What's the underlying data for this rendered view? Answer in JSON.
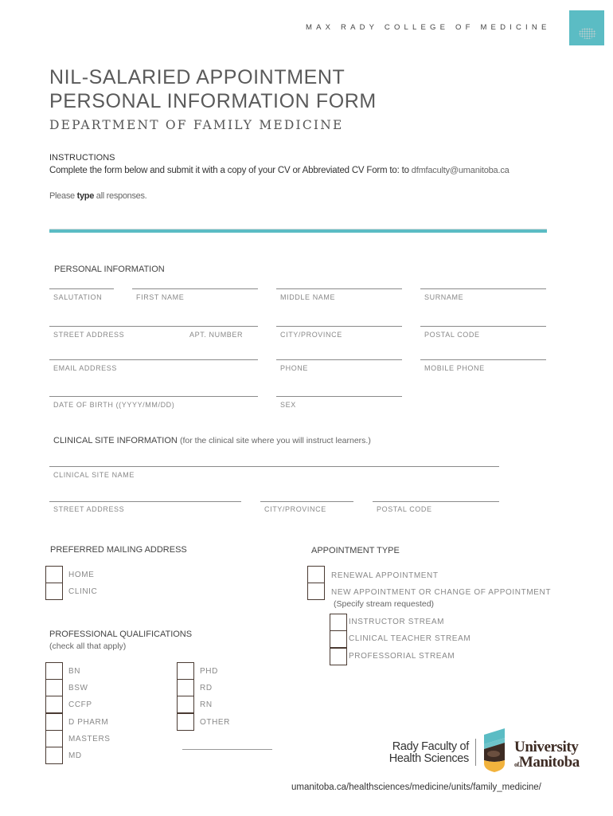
{
  "header": {
    "college": "MAX RADY COLLEGE OF MEDICINE",
    "brand_tile_icon": "medicine-brand-tile",
    "title_line1": "NIL-SALARIED APPOINTMENT",
    "title_line2": "PERSONAL INFORMATION FORM",
    "department": "DEPARTMENT OF FAMILY MEDICINE"
  },
  "instructions": {
    "heading": "INSTRUCTIONS",
    "body": "Complete the form below  and submit it with a copy of your CV or Abbreviated CV Form to: to ",
    "email": "dfmfaculty@umanitoba.ca",
    "please_prefix": "Please ",
    "please_bold": "type",
    "please_suffix": " all responses."
  },
  "colors": {
    "accent": "#5bbcc4",
    "checkbox_border": "#4a3a32",
    "um_brown": "#3d2b23",
    "um_gold": "#f2b33d"
  },
  "personal": {
    "heading": "PERSONAL INFORMATION",
    "fields": {
      "salutation": "SALUTATION",
      "first_name": "FIRST NAME",
      "middle_name": "MIDDLE NAME",
      "surname": "SURNAME",
      "street_address": "STREET ADDRESS",
      "apt_number": "APT. NUMBER",
      "city_province": "CITY/PROVINCE",
      "postal_code": "POSTAL CODE",
      "email": "EMAIL ADDRESS",
      "phone": "PHONE",
      "mobile_phone": "MOBILE PHONE",
      "dob": "DATE OF BIRTH ((YYYY/MM/DD)",
      "sex": "SEX"
    }
  },
  "clinical": {
    "heading": "CLINICAL SITE INFORMATION",
    "note": "(for the clinical site where you will instruct learners.)",
    "fields": {
      "site_name": "CLINICAL SITE NAME",
      "street_address": "STREET ADDRESS",
      "city_province": "CITY/PROVINCE",
      "postal_code": "POSTAL CODE"
    }
  },
  "mailing": {
    "heading": "PREFERRED MAILING ADDRESS",
    "options": [
      "HOME",
      "CLINIC"
    ]
  },
  "appointment": {
    "heading": "APPOINTMENT TYPE",
    "renewal": "RENEWAL APPOINTMENT",
    "new": "NEW APPOINTMENT OR CHANGE OF APPOINTMENT",
    "new_note": "(Specify stream requested)",
    "streams": [
      "INSTRUCTOR STREAM",
      "CLINICAL TEACHER STREAM",
      "PROFESSORIAL STREAM"
    ]
  },
  "qualifications": {
    "heading": "PROFESSIONAL QUALIFICATIONS",
    "note": "(check all that apply)",
    "col1": [
      "BN",
      "BSW",
      "CCFP",
      "D PHARM",
      "MASTERS",
      "MD"
    ],
    "col2": [
      "PHD",
      "RD",
      "RN",
      "OTHER"
    ]
  },
  "footer": {
    "rady_line1": "Rady Faculty of",
    "rady_line2": "Health Sciences",
    "um_line1": "University",
    "um_of": "of",
    "um_line2": "Manitoba",
    "url": "umanitoba.ca/healthsciences/medicine/units/family_medicine/"
  }
}
